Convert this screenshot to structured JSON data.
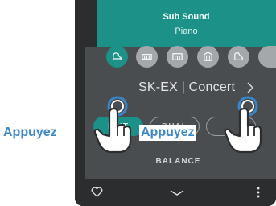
{
  "header": {
    "title": "Sub Sound",
    "subtitle": "Piano"
  },
  "categories": [
    {
      "icon": "grand-piano-icon",
      "selected": true
    },
    {
      "icon": "electric-piano-icon",
      "selected": false
    },
    {
      "icon": "keyboard-icon",
      "selected": false
    },
    {
      "icon": "organ-icon",
      "selected": false
    },
    {
      "icon": "harpsichord-icon",
      "selected": false
    }
  ],
  "sound": {
    "name": "SK-EX | Concert"
  },
  "modes": {
    "split": "PLIT",
    "dual": "DUAL"
  },
  "balance_label": "BALANCE",
  "overlay": {
    "press_left": "Appuyez",
    "press_right": "Appuyez"
  },
  "colors": {
    "accent": "#1b9188",
    "callout": "#3b86c8"
  }
}
